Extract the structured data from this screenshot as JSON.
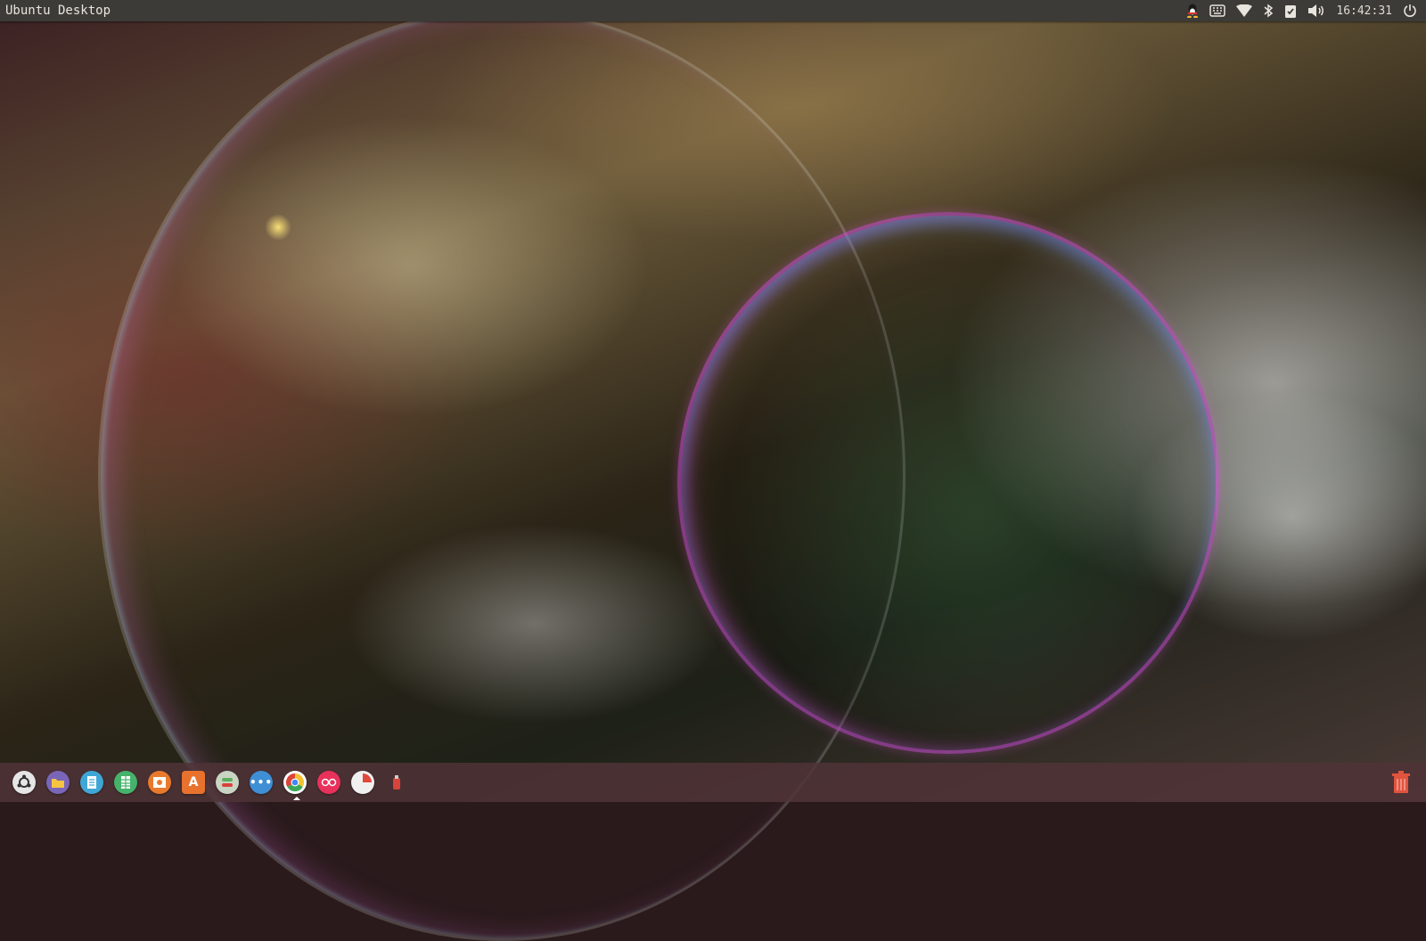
{
  "top_panel": {
    "title": "Ubuntu Desktop",
    "clock": "16:42:31",
    "indicators": [
      "qq-icon",
      "keyboard-icon",
      "wifi-icon",
      "bluetooth-icon",
      "clipboard-icon",
      "volume-icon",
      "power-icon"
    ]
  },
  "dock": {
    "apps": [
      {
        "name": "Dash Home",
        "icon": "ubuntu-logo-icon",
        "color": "#d8d8d8"
      },
      {
        "name": "Files",
        "icon": "folder-icon",
        "color": "#7a66b8"
      },
      {
        "name": "LibreOffice Writer",
        "icon": "document-icon",
        "color": "#3fa7d6"
      },
      {
        "name": "LibreOffice Calc",
        "icon": "spreadsheet-icon",
        "color": "#45b36b"
      },
      {
        "name": "LibreOffice Impress",
        "icon": "presentation-icon",
        "color": "#e87a2d"
      },
      {
        "name": "Ubuntu Software",
        "icon": "software-bag-icon",
        "color": "#e8722d"
      },
      {
        "name": "Mixer",
        "icon": "mixer-icon",
        "color": "#c9d4c2"
      },
      {
        "name": "Messaging",
        "icon": "chat-icon",
        "color": "#3f8fd6"
      },
      {
        "name": "Google Chrome",
        "icon": "chrome-icon",
        "color": "#ffffff",
        "running": true
      },
      {
        "name": "Flickr",
        "icon": "flickr-icon",
        "color": "#e8315b"
      },
      {
        "name": "Pie App",
        "icon": "pie-icon",
        "color": "#f0f0f0"
      },
      {
        "name": "USB",
        "icon": "usb-icon",
        "color": "#d8433a"
      }
    ],
    "trash_icon": "trash-icon"
  },
  "colors": {
    "panel_bg": "#3c3b37",
    "panel_text": "#e8e5de",
    "dock_bg": "#50323a",
    "trash": "#e0533d"
  }
}
